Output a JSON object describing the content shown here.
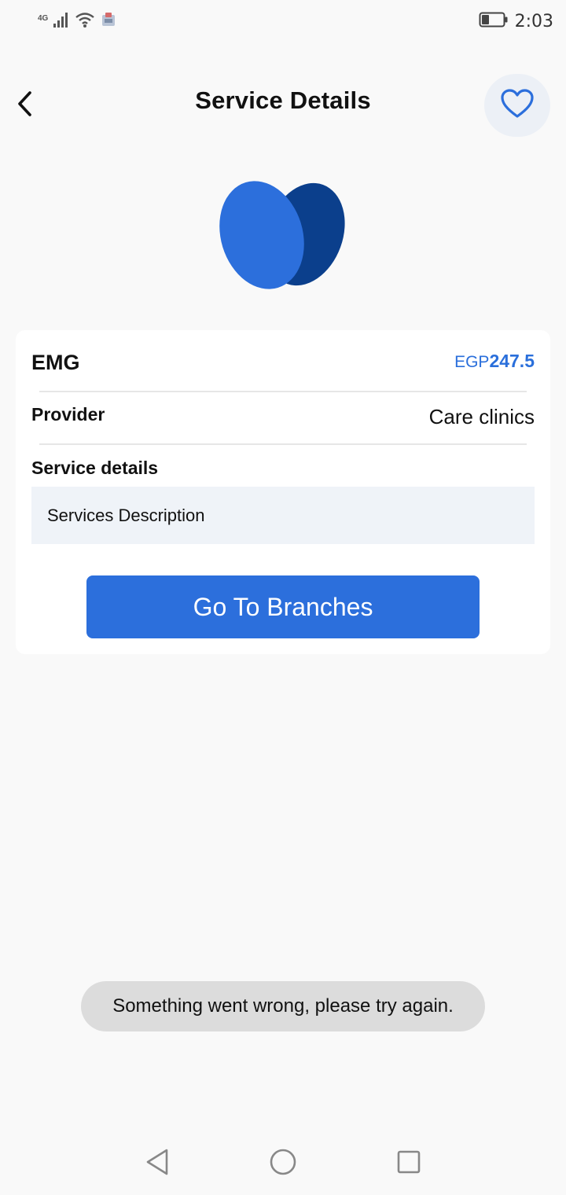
{
  "status_bar": {
    "network_type": "4G",
    "time": "2:03"
  },
  "header": {
    "title": "Service Details"
  },
  "service": {
    "name": "EMG",
    "price_currency": "EGP",
    "price_amount": "247.5",
    "provider_label": "Provider",
    "provider_value": "Care clinics",
    "details_label": "Service details",
    "description": "Services Description",
    "branches_button": "Go To Branches"
  },
  "toast": {
    "message": "Something went wrong, please try again."
  },
  "colors": {
    "accent": "#2c6fdc",
    "logo_light": "#2c6fdc",
    "logo_dark": "#0b3f8c",
    "background": "#f9f9f9"
  },
  "icons": {
    "back": "chevron-left-icon",
    "favorite": "heart-outline-icon",
    "nav_back": "triangle-back-icon",
    "nav_home": "circle-home-icon",
    "nav_recent": "square-recent-icon"
  }
}
